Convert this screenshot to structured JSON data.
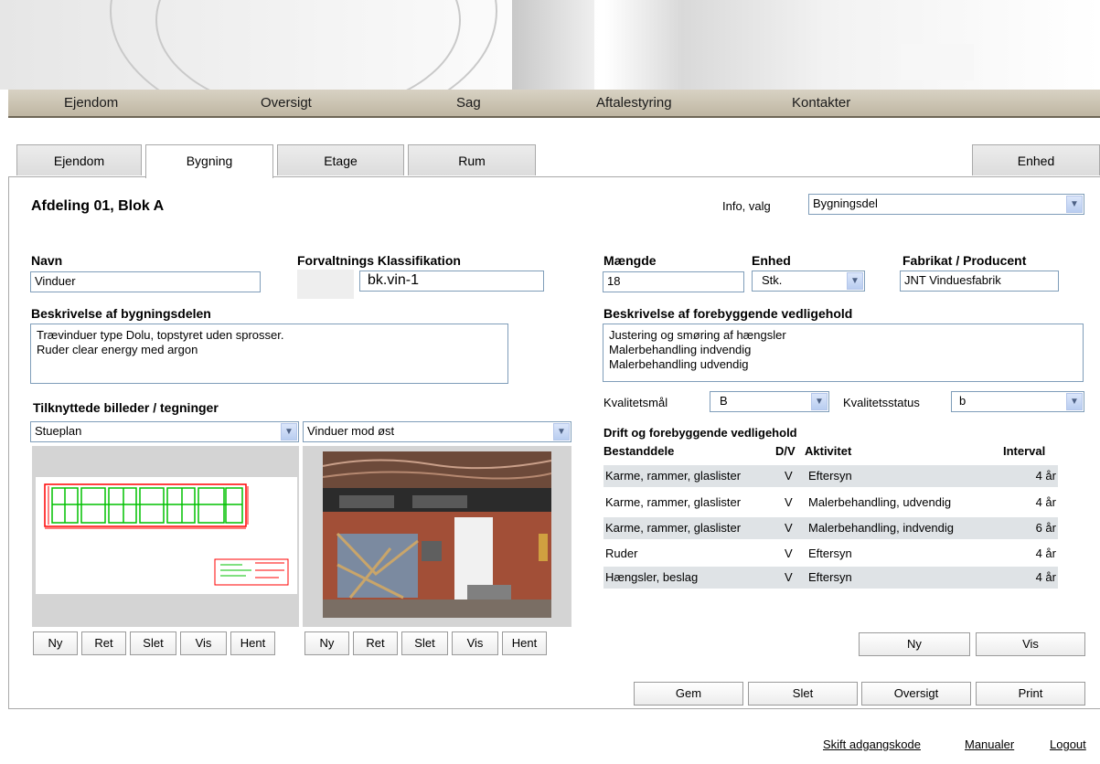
{
  "nav": [
    "Ejendom",
    "Oversigt",
    "Sag",
    "Aftalestyring",
    "Kontakter"
  ],
  "tabs": [
    "Ejendom",
    "Bygning",
    "Etage",
    "Rum",
    "Enhed"
  ],
  "page_title": "Afdeling 01, Blok A",
  "info": {
    "label": "Info, valg",
    "value": "Bygningsdel"
  },
  "fields": {
    "navn_label": "Navn",
    "navn_value": "Vinduer",
    "klass_label": "Forvaltnings Klassifikation",
    "klass_value": "bk.vin-1",
    "maengde_label": "Mængde",
    "maengde_value": "18",
    "enhed_label": "Enhed",
    "enhed_value": "Stk.",
    "fabrikat_label": "Fabrikat / Producent",
    "fabrikat_value": "JNT Vinduesfabrik"
  },
  "beskrivelse": {
    "label": "Beskrivelse af bygningsdelen",
    "text": "Trævinduer type Dolu, topstyret uden sprosser.\nRuder clear energy med argon"
  },
  "vedligehold": {
    "label": "Beskrivelse af forebyggende vedligehold",
    "text": "Justering og smøring af hængsler\nMalerbehandling indvendig\nMalerbehandling udvendig"
  },
  "kvalitet": {
    "maal_label": "Kvalitetsmål",
    "maal_value": "B",
    "status_label": "Kvalitetsstatus",
    "status_value": "b"
  },
  "billeder": {
    "label": "Tilknyttede billeder / tegninger",
    "select1": "Stueplan",
    "select2": "Vinduer mod øst",
    "buttons": [
      "Ny",
      "Ret",
      "Slet",
      "Vis",
      "Hent"
    ]
  },
  "drift": {
    "title": "Drift og forebyggende vedligehold",
    "headers": [
      "Bestanddele",
      "D/V",
      "Aktivitet",
      "Interval"
    ],
    "rows": [
      [
        "Karme, rammer, glaslister",
        "V",
        "Eftersyn",
        "4 år"
      ],
      [
        "Karme, rammer, glaslister",
        "V",
        "Malerbehandling, udvendig",
        "4 år"
      ],
      [
        "Karme, rammer, glaslister",
        "V",
        "Malerbehandling, indvendig",
        "6 år"
      ],
      [
        "Ruder",
        "V",
        "Eftersyn",
        "4 år"
      ],
      [
        "Hængsler, beslag",
        "V",
        "Eftersyn",
        "4 år"
      ]
    ],
    "ny": "Ny",
    "vis": "Vis"
  },
  "actions": {
    "gem": "Gem",
    "slet": "Slet",
    "oversigt": "Oversigt",
    "print": "Print"
  },
  "footer": {
    "skift": "Skift adgangskode",
    "manualer": "Manualer",
    "logout": "Logout"
  }
}
